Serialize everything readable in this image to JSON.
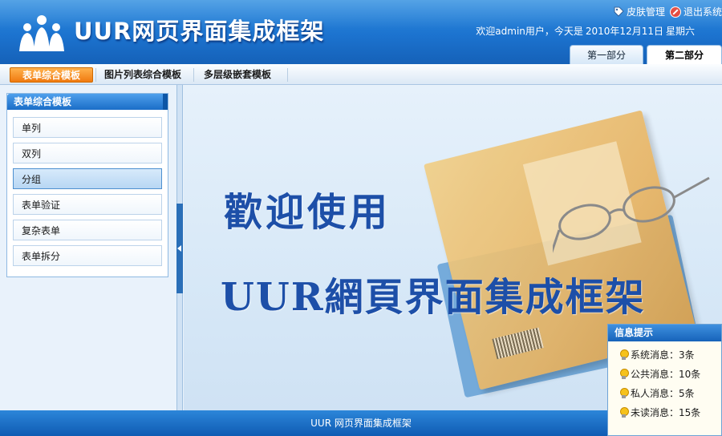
{
  "header": {
    "title": "UUR网页界面集成框架",
    "skin_link": "皮肤管理",
    "exit_link": "退出系统",
    "welcome_prefix": "欢迎admin用户，今天是",
    "date": "2010年12月11日",
    "weekday": "星期六"
  },
  "part_tabs": [
    "第一部分",
    "第二部分"
  ],
  "nav": [
    "表单综合模板",
    "图片列表综合模板",
    "多层级嵌套模板"
  ],
  "sidebar": {
    "title": "表单综合模板",
    "items": [
      "单列",
      "双列",
      "分组",
      "表单验证",
      "复杂表单",
      "表单拆分"
    ],
    "active_index": 2
  },
  "main": {
    "welcome_line1": "歡迎使用",
    "welcome_line2": "UUR網頁界面集成框架"
  },
  "footer": {
    "text": "UUR 网页界面集成框架"
  },
  "info_panel": {
    "title": "信息提示",
    "items": [
      "系统消息：3条",
      "公共消息：10条",
      "私人消息：5条",
      "未读消息：15条"
    ]
  },
  "colors": {
    "header_blue": "#1c73cf",
    "nav_active": "#f07a10",
    "headline_blue": "#1d4fa8"
  },
  "icons": {
    "logo": "people-group-icon",
    "skin": "tag-icon",
    "exit": "exit-icon",
    "info": "lightbulb-icon"
  }
}
